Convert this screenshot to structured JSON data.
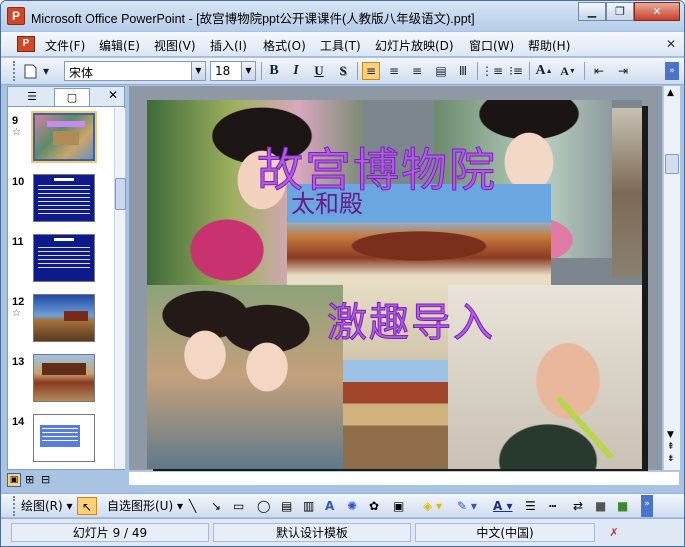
{
  "window": {
    "title": "Microsoft Office PowerPoint - [故宫博物院ppt公开课课件(人教版八年级语文).ppt]",
    "app_icon": "P",
    "buttons": [
      "minimize",
      "restore",
      "close"
    ]
  },
  "menubar": {
    "items": [
      "文件(F)",
      "编辑(E)",
      "视图(V)",
      "插入(I)",
      "格式(O)",
      "工具(T)",
      "幻灯片放映(D)",
      "窗口(W)",
      "帮助(H)"
    ],
    "close_symbol": "✕"
  },
  "toolbar": {
    "font_name": "宋体",
    "font_size": "18",
    "bold": "B",
    "italic": "I",
    "underline": "U",
    "shadow": "S",
    "increase_font": "A",
    "decrease_font": "A"
  },
  "slides_pane": {
    "tab_outline": "☰",
    "tab_slides": "▢",
    "close": "✕",
    "thumbs": [
      {
        "num": "9",
        "star": "☆",
        "selected": true
      },
      {
        "num": "10",
        "star": "",
        "selected": false
      },
      {
        "num": "11",
        "star": "",
        "selected": false
      },
      {
        "num": "12",
        "star": "☆",
        "selected": false
      },
      {
        "num": "13",
        "star": "",
        "selected": false
      },
      {
        "num": "14",
        "star": "",
        "selected": false
      }
    ]
  },
  "slide": {
    "title_top": "故宫博物院",
    "label": "太和殿",
    "title_bottom": "激趣导入"
  },
  "drawbar": {
    "draw_label": "绘图(R)",
    "autoshapes_label": "自选图形(U)"
  },
  "statusbar": {
    "slide_info": "幻灯片 9 / 49",
    "template": "默认设计模板",
    "language": "中文(中国)"
  },
  "colors": {
    "accent": "#3a62a9",
    "title_purple": "#b25ee0"
  }
}
